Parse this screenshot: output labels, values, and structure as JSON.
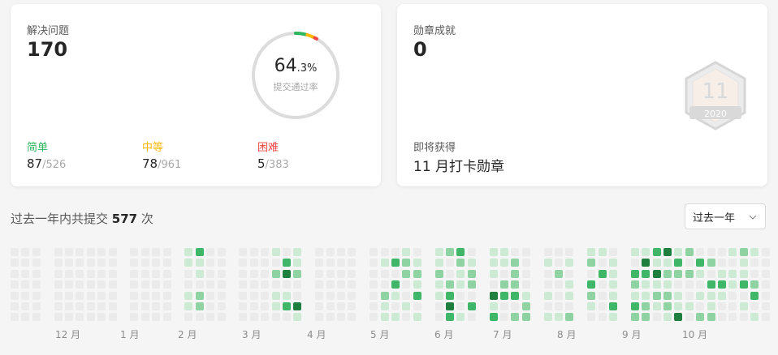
{
  "solved": {
    "title": "解决问题",
    "count": "170",
    "acceptance_int": "64",
    "acceptance_frac": ".3%",
    "acceptance_label": "提交通过率",
    "acceptance_value": 64.3,
    "difficulty": [
      {
        "label": "简单",
        "solved": "87",
        "total": "/526",
        "color": "#2db55d"
      },
      {
        "label": "中等",
        "solved": "78",
        "total": "/961",
        "color": "#ffb800"
      },
      {
        "label": "困难",
        "solved": "5",
        "total": "/383",
        "color": "#ef4743"
      }
    ]
  },
  "badges": {
    "title": "勋章成就",
    "count": "0",
    "upcoming_label": "即将获得",
    "upcoming_name": "11 月打卡勋章",
    "badge_number": "11",
    "badge_year": "2020",
    "icon": "hexagon-badge-icon"
  },
  "submissions": {
    "prefix": "过去一年内共提交",
    "count": "577",
    "suffix": "次",
    "range_selected": "过去一年"
  },
  "heatmap": {
    "months": [
      "12 月",
      "1 月",
      "2 月",
      "3 月",
      "4 月",
      "5 月",
      "6 月",
      "7 月",
      "8 月",
      "9 月",
      "10 月"
    ],
    "colors": [
      "#ebebeb",
      "#cdebd4",
      "#8fd3a2",
      "#40b768",
      "#1f7f3f"
    ]
  }
}
